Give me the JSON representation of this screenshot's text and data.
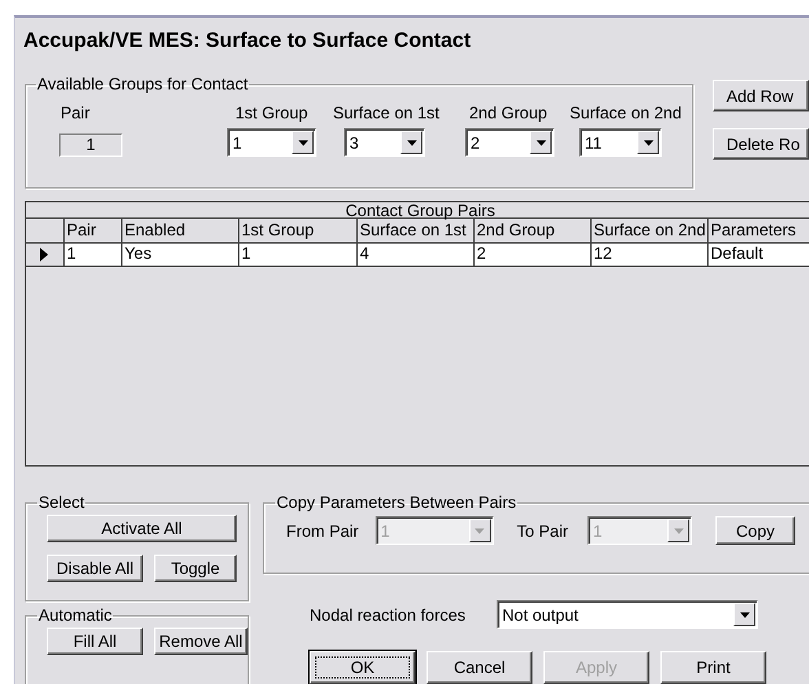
{
  "window": {
    "title": "Accupak/VE MES: Surface to Surface Contact"
  },
  "available_groups": {
    "title": "Available Groups for Contact",
    "pair": {
      "label": "Pair",
      "value": "1"
    },
    "selectors": [
      {
        "label": "1st Group",
        "value": "1"
      },
      {
        "label": "Surface on 1st",
        "value": "3"
      },
      {
        "label": "2nd Group",
        "value": "2"
      },
      {
        "label": "Surface on 2nd",
        "value": "11"
      }
    ]
  },
  "row_buttons": [
    "Add Row",
    "Delete Ro"
  ],
  "table": {
    "title": "Contact Group Pairs",
    "columns": [
      "Pair",
      "Enabled",
      "1st Group",
      "Surface on 1st",
      "2nd Group",
      "Surface on 2nd",
      "Parameters"
    ],
    "rows": [
      {
        "selected": true,
        "cells": [
          "1",
          "Yes",
          "1",
          "4",
          "2",
          "12",
          "Default"
        ]
      }
    ]
  },
  "select": {
    "title": "Select",
    "buttons": [
      "Activate All",
      "Disable All",
      "Toggle"
    ]
  },
  "automatic": {
    "title": "Automatic",
    "buttons": [
      "Fill All",
      "Remove All"
    ]
  },
  "copy": {
    "title": "Copy Parameters Between Pairs",
    "from": {
      "label": "From Pair",
      "value": "1",
      "disabled": true
    },
    "to": {
      "label": "To Pair",
      "value": "1",
      "disabled": true
    },
    "button": "Copy"
  },
  "nodal": {
    "label": "Nodal reaction forces",
    "value": "Not output"
  },
  "dialog_buttons": [
    {
      "label": "OK",
      "default": true,
      "disabled": false
    },
    {
      "label": "Cancel",
      "default": false,
      "disabled": false
    },
    {
      "label": "Apply",
      "default": false,
      "disabled": true
    },
    {
      "label": "Print",
      "default": false,
      "disabled": false
    }
  ]
}
